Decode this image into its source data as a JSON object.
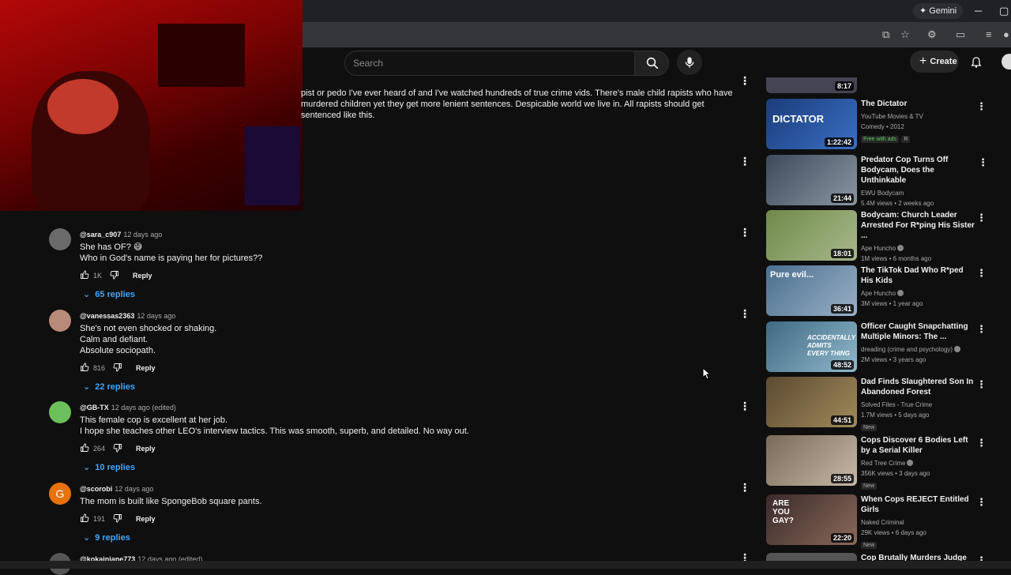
{
  "browser": {
    "gemini_label": "Gemini",
    "minimize": "─",
    "maximize": "▢"
  },
  "header": {
    "search_placeholder": "Search",
    "create_label": "Create"
  },
  "top_comment": {
    "text": "pist or pedo I've ever heard of and I've watched hundreds of true crime vids. There's male child rapists who have murdered children yet they get more lenient sentences. Despicable world we live in. All rapists should get sentenced like this."
  },
  "comments": [
    {
      "author": "@sara_c907",
      "time": "12 days ago",
      "lines": [
        "She has OF? 😅",
        "Who in God's name is paying her for pictures??"
      ],
      "likes": "1K",
      "reply_label": "Reply",
      "replies": "65 replies",
      "avatar_color": "#6b6b6b"
    },
    {
      "author": "@vanessas2363",
      "time": "12 days ago",
      "lines": [
        "She's not even shocked or shaking.",
        "Calm and defiant.",
        "Absolute sociopath."
      ],
      "likes": "816",
      "reply_label": "Reply",
      "replies": "22 replies",
      "avatar_color": "#b88a7a"
    },
    {
      "author": "@GB-TX",
      "time": "12 days ago (edited)",
      "lines": [
        "This female cop is excellent at her job.",
        "I hope she teaches other LEO's interview tactics. This was smooth, superb, and detailed. No way out."
      ],
      "likes": "264",
      "reply_label": "Reply",
      "replies": "10 replies",
      "avatar_color": "#6cbf5a"
    },
    {
      "author": "@scorobi",
      "time": "12 days ago",
      "lines": [
        "The mom is built like SpongeBob square pants."
      ],
      "likes": "191",
      "reply_label": "Reply",
      "replies": "9 replies",
      "avatar_color": "#e8710a",
      "avatar_letter": "G"
    },
    {
      "author": "@kokainjane773",
      "time": "12 days ago (edited)",
      "lines": [],
      "likes": "",
      "reply_label": "",
      "replies": "",
      "avatar_color": "#555555"
    }
  ],
  "sidebar": {
    "partial_top_duration": "8:17",
    "videos": [
      {
        "title": "The Dictator",
        "channel": "YouTube Movies & TV",
        "meta": "Comedy • 2012",
        "badge": "Free with ads",
        "rating": "R",
        "duration": "1:22:42",
        "thumb_text": "DICTATOR",
        "thumb_color": "#1b3c7a"
      },
      {
        "title": "Predator Cop Turns Off Bodycam, Does the Unthinkable",
        "channel": "EWU Bodycam",
        "meta": "5.4M views • 2 weeks ago",
        "duration": "21:44",
        "thumb_color": "#4d5c6e"
      },
      {
        "title": "Bodycam: Church Leader Arrested For R*ping His Sister ...",
        "channel": "Ape Huncho",
        "meta": "1M views • 6 months ago",
        "duration": "18:01",
        "thumb_color": "#6f8a4a"
      },
      {
        "title": "The TikTok Dad Who R*ped His Kids",
        "channel": "Ape Huncho",
        "meta": "3M views • 1 year ago",
        "duration": "36:41",
        "thumb_text": "Pure evil...",
        "thumb_color": "#4a6f8f"
      },
      {
        "title": "Officer Caught Snapchatting Multiple Minors: The ...",
        "channel": "dreading (crime and psychology)",
        "meta": "2M views • 3 years ago",
        "duration": "48:52",
        "thumb_text": "ACCIDENTALLY ADMITS EVERY THING",
        "thumb_color": "#3f6a82"
      },
      {
        "title": "Dad Finds Slaughtered Son In Abandoned Forest",
        "channel": "Solved Files - True Crime",
        "meta": "1.7M views • 5 days ago",
        "badge": "New",
        "duration": "44:51",
        "thumb_color": "#5c4a32"
      },
      {
        "title": "Cops Discover 6 Bodies Left by a Serial Killer",
        "channel": "Red Tree Crime",
        "meta": "356K views • 3 days ago",
        "badge": "New",
        "duration": "28:55",
        "thumb_color": "#7a6a5a"
      },
      {
        "title": "When Cops REJECT Entitled Girls",
        "channel": "Naked Criminal",
        "meta": "29K views • 6 days ago",
        "badge": "New",
        "duration": "22:20",
        "thumb_text": "ARE YOU GAY?",
        "thumb_color": "#3a2a2a"
      },
      {
        "title": "Cop Brutally Murders Judge In ...",
        "channel": "",
        "meta": "",
        "duration": "",
        "thumb_color": "#555"
      }
    ]
  }
}
